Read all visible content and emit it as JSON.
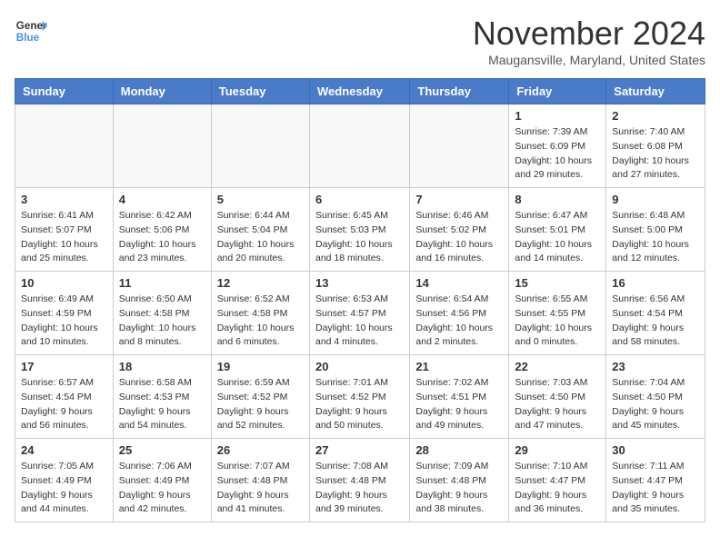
{
  "header": {
    "logo_line1": "General",
    "logo_line2": "Blue",
    "month": "November 2024",
    "location": "Maugansville, Maryland, United States"
  },
  "weekdays": [
    "Sunday",
    "Monday",
    "Tuesday",
    "Wednesday",
    "Thursday",
    "Friday",
    "Saturday"
  ],
  "weeks": [
    [
      {
        "day": "",
        "info": ""
      },
      {
        "day": "",
        "info": ""
      },
      {
        "day": "",
        "info": ""
      },
      {
        "day": "",
        "info": ""
      },
      {
        "day": "",
        "info": ""
      },
      {
        "day": "1",
        "info": "Sunrise: 7:39 AM\nSunset: 6:09 PM\nDaylight: 10 hours and 29 minutes."
      },
      {
        "day": "2",
        "info": "Sunrise: 7:40 AM\nSunset: 6:08 PM\nDaylight: 10 hours and 27 minutes."
      }
    ],
    [
      {
        "day": "3",
        "info": "Sunrise: 6:41 AM\nSunset: 5:07 PM\nDaylight: 10 hours and 25 minutes."
      },
      {
        "day": "4",
        "info": "Sunrise: 6:42 AM\nSunset: 5:06 PM\nDaylight: 10 hours and 23 minutes."
      },
      {
        "day": "5",
        "info": "Sunrise: 6:44 AM\nSunset: 5:04 PM\nDaylight: 10 hours and 20 minutes."
      },
      {
        "day": "6",
        "info": "Sunrise: 6:45 AM\nSunset: 5:03 PM\nDaylight: 10 hours and 18 minutes."
      },
      {
        "day": "7",
        "info": "Sunrise: 6:46 AM\nSunset: 5:02 PM\nDaylight: 10 hours and 16 minutes."
      },
      {
        "day": "8",
        "info": "Sunrise: 6:47 AM\nSunset: 5:01 PM\nDaylight: 10 hours and 14 minutes."
      },
      {
        "day": "9",
        "info": "Sunrise: 6:48 AM\nSunset: 5:00 PM\nDaylight: 10 hours and 12 minutes."
      }
    ],
    [
      {
        "day": "10",
        "info": "Sunrise: 6:49 AM\nSunset: 4:59 PM\nDaylight: 10 hours and 10 minutes."
      },
      {
        "day": "11",
        "info": "Sunrise: 6:50 AM\nSunset: 4:58 PM\nDaylight: 10 hours and 8 minutes."
      },
      {
        "day": "12",
        "info": "Sunrise: 6:52 AM\nSunset: 4:58 PM\nDaylight: 10 hours and 6 minutes."
      },
      {
        "day": "13",
        "info": "Sunrise: 6:53 AM\nSunset: 4:57 PM\nDaylight: 10 hours and 4 minutes."
      },
      {
        "day": "14",
        "info": "Sunrise: 6:54 AM\nSunset: 4:56 PM\nDaylight: 10 hours and 2 minutes."
      },
      {
        "day": "15",
        "info": "Sunrise: 6:55 AM\nSunset: 4:55 PM\nDaylight: 10 hours and 0 minutes."
      },
      {
        "day": "16",
        "info": "Sunrise: 6:56 AM\nSunset: 4:54 PM\nDaylight: 9 hours and 58 minutes."
      }
    ],
    [
      {
        "day": "17",
        "info": "Sunrise: 6:57 AM\nSunset: 4:54 PM\nDaylight: 9 hours and 56 minutes."
      },
      {
        "day": "18",
        "info": "Sunrise: 6:58 AM\nSunset: 4:53 PM\nDaylight: 9 hours and 54 minutes."
      },
      {
        "day": "19",
        "info": "Sunrise: 6:59 AM\nSunset: 4:52 PM\nDaylight: 9 hours and 52 minutes."
      },
      {
        "day": "20",
        "info": "Sunrise: 7:01 AM\nSunset: 4:52 PM\nDaylight: 9 hours and 50 minutes."
      },
      {
        "day": "21",
        "info": "Sunrise: 7:02 AM\nSunset: 4:51 PM\nDaylight: 9 hours and 49 minutes."
      },
      {
        "day": "22",
        "info": "Sunrise: 7:03 AM\nSunset: 4:50 PM\nDaylight: 9 hours and 47 minutes."
      },
      {
        "day": "23",
        "info": "Sunrise: 7:04 AM\nSunset: 4:50 PM\nDaylight: 9 hours and 45 minutes."
      }
    ],
    [
      {
        "day": "24",
        "info": "Sunrise: 7:05 AM\nSunset: 4:49 PM\nDaylight: 9 hours and 44 minutes."
      },
      {
        "day": "25",
        "info": "Sunrise: 7:06 AM\nSunset: 4:49 PM\nDaylight: 9 hours and 42 minutes."
      },
      {
        "day": "26",
        "info": "Sunrise: 7:07 AM\nSunset: 4:48 PM\nDaylight: 9 hours and 41 minutes."
      },
      {
        "day": "27",
        "info": "Sunrise: 7:08 AM\nSunset: 4:48 PM\nDaylight: 9 hours and 39 minutes."
      },
      {
        "day": "28",
        "info": "Sunrise: 7:09 AM\nSunset: 4:48 PM\nDaylight: 9 hours and 38 minutes."
      },
      {
        "day": "29",
        "info": "Sunrise: 7:10 AM\nSunset: 4:47 PM\nDaylight: 9 hours and 36 minutes."
      },
      {
        "day": "30",
        "info": "Sunrise: 7:11 AM\nSunset: 4:47 PM\nDaylight: 9 hours and 35 minutes."
      }
    ]
  ]
}
